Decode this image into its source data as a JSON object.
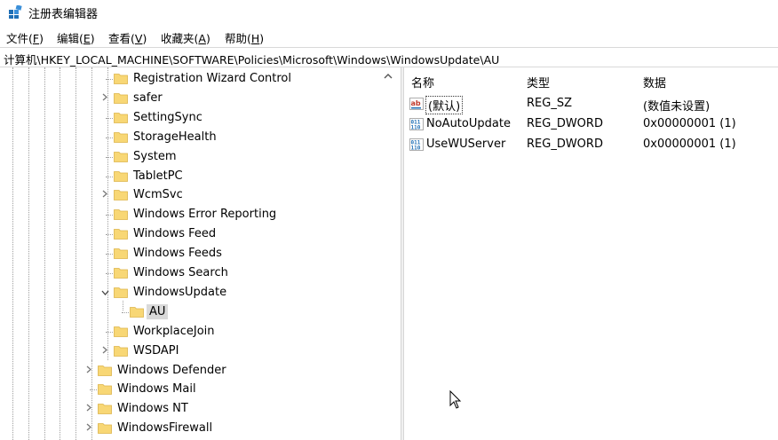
{
  "window": {
    "title": "注册表编辑器"
  },
  "menu": [
    {
      "label": "文件(",
      "key": "F",
      "suffix": ")"
    },
    {
      "label": "编辑(",
      "key": "E",
      "suffix": ")"
    },
    {
      "label": "查看(",
      "key": "V",
      "suffix": ")"
    },
    {
      "label": "收藏夹(",
      "key": "A",
      "suffix": ")"
    },
    {
      "label": "帮助(",
      "key": "H",
      "suffix": ")"
    }
  ],
  "address": {
    "path": "计算机\\HKEY_LOCAL_MACHINE\\SOFTWARE\\Policies\\Microsoft\\Windows\\WindowsUpdate\\AU"
  },
  "tree": {
    "nodes": [
      {
        "label": "Registration Wizard Control",
        "level": 3,
        "expander": "none"
      },
      {
        "label": "safer",
        "level": 3,
        "expander": "collapsed"
      },
      {
        "label": "SettingSync",
        "level": 3,
        "expander": "none"
      },
      {
        "label": "StorageHealth",
        "level": 3,
        "expander": "none"
      },
      {
        "label": "System",
        "level": 3,
        "expander": "none"
      },
      {
        "label": "TabletPC",
        "level": 3,
        "expander": "none"
      },
      {
        "label": "WcmSvc",
        "level": 3,
        "expander": "collapsed"
      },
      {
        "label": "Windows Error Reporting",
        "level": 3,
        "expander": "none"
      },
      {
        "label": "Windows Feed",
        "level": 3,
        "expander": "none"
      },
      {
        "label": "Windows Feeds",
        "level": 3,
        "expander": "none"
      },
      {
        "label": "Windows Search",
        "level": 3,
        "expander": "none"
      },
      {
        "label": "WindowsUpdate",
        "level": 3,
        "expander": "expanded"
      },
      {
        "label": "AU",
        "level": 4,
        "expander": "none",
        "selected": true
      },
      {
        "label": "WorkplaceJoin",
        "level": 3,
        "expander": "none"
      },
      {
        "label": "WSDAPI",
        "level": 3,
        "expander": "collapsed"
      },
      {
        "label": "Windows Defender",
        "level": 2,
        "expander": "collapsed"
      },
      {
        "label": "Windows Mail",
        "level": 2,
        "expander": "none"
      },
      {
        "label": "Windows NT",
        "level": 2,
        "expander": "collapsed"
      },
      {
        "label": "WindowsFirewall",
        "level": 2,
        "expander": "collapsed"
      }
    ]
  },
  "list": {
    "columns": {
      "name": "名称",
      "type": "类型",
      "data": "数据"
    },
    "rows": [
      {
        "icon": "string-value-icon",
        "name": "(默认)",
        "type": "REG_SZ",
        "data": "(数值未设置)"
      },
      {
        "icon": "binary-value-icon",
        "name": "NoAutoUpdate",
        "type": "REG_DWORD",
        "data": "0x00000001 (1)"
      },
      {
        "icon": "binary-value-icon",
        "name": "UseWUServer",
        "type": "REG_DWORD",
        "data": "0x00000001 (1)"
      }
    ]
  },
  "colors": {
    "folder": "#f8d775",
    "folder_edge": "#dcb44a",
    "selection": "#d9d9d9",
    "icon_blue": "#1f6fb5",
    "icon_red": "#c0392b"
  }
}
